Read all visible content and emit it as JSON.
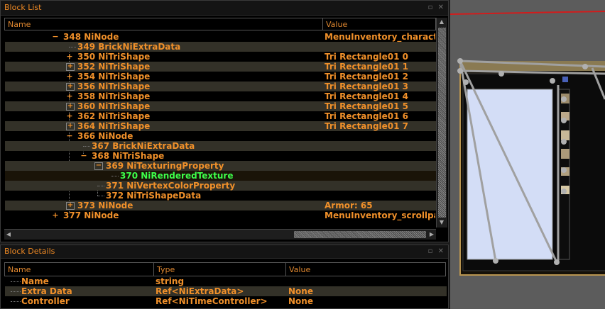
{
  "block_list": {
    "title": "Block List",
    "columns": [
      "Name",
      "Value"
    ],
    "rows": [
      {
        "name": "348 NiNode",
        "value": "MenuInventory_character"
      },
      {
        "name": "349 BrickNiExtraData",
        "value": ""
      },
      {
        "name": "350 NiTriShape",
        "value": "Tri Rectangle01 0"
      },
      {
        "name": "352 NiTriShape",
        "value": "Tri Rectangle01 1"
      },
      {
        "name": "354 NiTriShape",
        "value": "Tri Rectangle01 2"
      },
      {
        "name": "356 NiTriShape",
        "value": "Tri Rectangle01 3"
      },
      {
        "name": "358 NiTriShape",
        "value": "Tri Rectangle01 4"
      },
      {
        "name": "360 NiTriShape",
        "value": "Tri Rectangle01 5"
      },
      {
        "name": "362 NiTriShape",
        "value": "Tri Rectangle01 6"
      },
      {
        "name": "364 NiTriShape",
        "value": "Tri Rectangle01 7"
      },
      {
        "name": "366 NiNode",
        "value": ""
      },
      {
        "name": "367 BrickNiExtraData",
        "value": ""
      },
      {
        "name": "368 NiTriShape",
        "value": ""
      },
      {
        "name": "369 NiTexturingProperty",
        "value": ""
      },
      {
        "name": "370 NiRenderedTexture",
        "value": ""
      },
      {
        "name": "371 NiVertexColorProperty",
        "value": ""
      },
      {
        "name": "372 NiTriShapeData",
        "value": ""
      },
      {
        "name": "373 NiNode",
        "value": "Armor: 65"
      },
      {
        "name": "377 NiNode",
        "value": "MenuInventory_scrollpan"
      }
    ]
  },
  "block_details": {
    "title": "Block Details",
    "columns": [
      "Name",
      "Type",
      "Value"
    ],
    "rows": [
      {
        "name": "Name",
        "type": "string",
        "value": ""
      },
      {
        "name": "Extra Data",
        "type": "Ref<NiExtraData>",
        "value": "None"
      },
      {
        "name": "Controller",
        "type": "Ref<NiTimeController>",
        "value": "None"
      }
    ]
  },
  "colors": {
    "accent": "#f0902a",
    "selected_text": "#3dff4a",
    "panel_bg": "#000000"
  }
}
